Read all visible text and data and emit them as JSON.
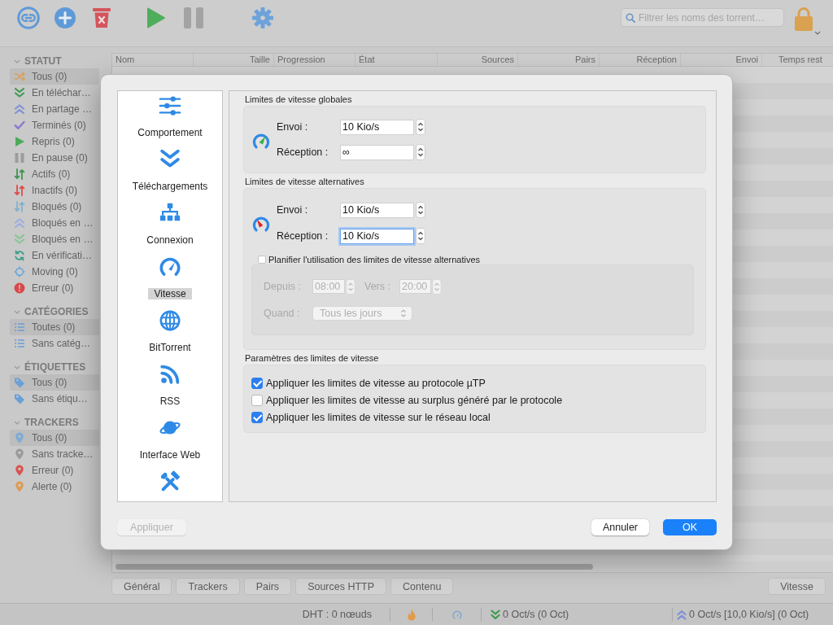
{
  "toolbar": {
    "search": {
      "placeholder": "Filtrer les noms des torrent…"
    }
  },
  "sidebar": {
    "sections": [
      {
        "title": "STATUT",
        "expanded": true,
        "items": [
          {
            "label": "Tous (0)",
            "kind": "all",
            "selected": true
          },
          {
            "label": "En téléchar…",
            "kind": "downloading",
            "selected": false
          },
          {
            "label": "En partage …",
            "kind": "seeding",
            "selected": false
          },
          {
            "label": "Terminés (0)",
            "kind": "completed",
            "selected": false
          },
          {
            "label": "Repris (0)",
            "kind": "resumed",
            "selected": false
          },
          {
            "label": "En pause (0)",
            "kind": "paused",
            "selected": false
          },
          {
            "label": "Actifs (0)",
            "kind": "active",
            "selected": false
          },
          {
            "label": "Inactifs (0)",
            "kind": "inactive",
            "selected": false
          },
          {
            "label": "Bloqués (0)",
            "kind": "stalled",
            "selected": false
          },
          {
            "label": "Bloqués en …",
            "kind": "stalled-up",
            "selected": false
          },
          {
            "label": "Bloqués en …",
            "kind": "stalled-down",
            "selected": false
          },
          {
            "label": "En vérificati…",
            "kind": "checking",
            "selected": false
          },
          {
            "label": "Moving (0)",
            "kind": "moving",
            "selected": false
          },
          {
            "label": "Erreur (0)",
            "kind": "error",
            "selected": false
          }
        ]
      },
      {
        "title": "CATÉGORIES",
        "expanded": true,
        "items": [
          {
            "label": "Toutes (0)",
            "kind": "category",
            "selected": true
          },
          {
            "label": "Sans catég…",
            "kind": "category",
            "selected": false
          }
        ]
      },
      {
        "title": "ÉTIQUETTES",
        "expanded": true,
        "items": [
          {
            "label": "Tous (0)",
            "kind": "tag",
            "selected": true
          },
          {
            "label": "Sans étiqu…",
            "kind": "tag",
            "selected": false
          }
        ]
      },
      {
        "title": "TRACKERS",
        "expanded": true,
        "items": [
          {
            "label": "Tous (0)",
            "kind": "tracker",
            "color": "#7eaad8",
            "selected": true
          },
          {
            "label": "Sans tracke…",
            "kind": "tracker",
            "color": "#9a9a9a",
            "selected": false
          },
          {
            "label": "Erreur (0)",
            "kind": "tracker",
            "color": "#d9524f",
            "selected": false
          },
          {
            "label": "Alerte (0)",
            "kind": "tracker",
            "color": "#dc9c55",
            "selected": false
          }
        ]
      }
    ]
  },
  "table": {
    "columns": [
      {
        "label": "Nom",
        "kind": "text"
      },
      {
        "label": "Taille",
        "kind": "number"
      },
      {
        "label": "Progression",
        "kind": "text"
      },
      {
        "label": "État",
        "kind": "text"
      },
      {
        "label": "Sources",
        "kind": "number"
      },
      {
        "label": "Pairs",
        "kind": "number"
      },
      {
        "label": "Réception",
        "kind": "number"
      },
      {
        "label": "Envoi",
        "kind": "number"
      },
      {
        "label": "Temps rest",
        "kind": "text"
      }
    ]
  },
  "detail_tabs": [
    {
      "label": "Général",
      "selected": false
    },
    {
      "label": "Trackers",
      "selected": false
    },
    {
      "label": "Pairs",
      "selected": false
    },
    {
      "label": "Sources HTTP",
      "selected": false
    },
    {
      "label": "Contenu",
      "selected": false
    }
  ],
  "detail_tabs_right": [
    {
      "label": "Vitesse",
      "selected": false
    }
  ],
  "status_bar": {
    "dht": "DHT : 0 nœuds",
    "download": "0 Oct/s (0 Oct)",
    "upload": "0 Oct/s [10,0 Kio/s] (0 Oct)"
  },
  "dialog": {
    "nav": [
      {
        "label": "Comportement",
        "kind": "behaviour",
        "selected": false
      },
      {
        "label": "Téléchargements",
        "kind": "downloads",
        "selected": false
      },
      {
        "label": "Connexion",
        "kind": "connection",
        "selected": false
      },
      {
        "label": "Vitesse",
        "kind": "speed",
        "selected": true
      },
      {
        "label": "BitTorrent",
        "kind": "bittorrent",
        "selected": false
      },
      {
        "label": "RSS",
        "kind": "rss",
        "selected": false
      },
      {
        "label": "Interface Web",
        "kind": "webui",
        "selected": false
      },
      {
        "kind": "advanced",
        "selected": false
      }
    ],
    "groups": [
      {
        "title": "Limites de vitesse globales",
        "kind": "normal",
        "fields": [
          {
            "label": "Envoi :",
            "value": "10 Kio/s",
            "focused": false
          },
          {
            "label": "Réception :",
            "value": "∞",
            "focused": false
          }
        ]
      },
      {
        "title": "Limites de vitesse alternatives",
        "kind": "alternative",
        "fields": [
          {
            "label": "Envoi :",
            "value": "10 Kio/s",
            "focused": false
          },
          {
            "label": "Réception :",
            "value": "10 Kio/s",
            "focused": true
          }
        ],
        "schedule": {
          "option": {
            "label": "Planifier l'utilisation des limites de vitesse alternatives",
            "checked": false
          },
          "disabled": true,
          "from": {
            "label": "Depuis :",
            "value": "08:00"
          },
          "to": {
            "label": "Vers :",
            "value": "20:00"
          },
          "when": {
            "label": "Quand :",
            "value": "Tous les jours"
          }
        }
      }
    ],
    "settings": {
      "title": "Paramètres des limites de vitesse",
      "options": [
        {
          "label": "Appliquer les limites de vitesse au protocole µTP",
          "checked": true
        },
        {
          "label": "Appliquer les limites de vitesse au surplus généré par le protocole",
          "checked": false
        },
        {
          "label": "Appliquer les limites de vitesse sur le réseau local",
          "checked": true
        }
      ]
    },
    "apply": {
      "label": "Appliquer",
      "disabled": true
    },
    "actions": [
      {
        "label": "Annuler",
        "kind": "cancel"
      },
      {
        "label": "OK",
        "kind": "ok"
      }
    ]
  }
}
